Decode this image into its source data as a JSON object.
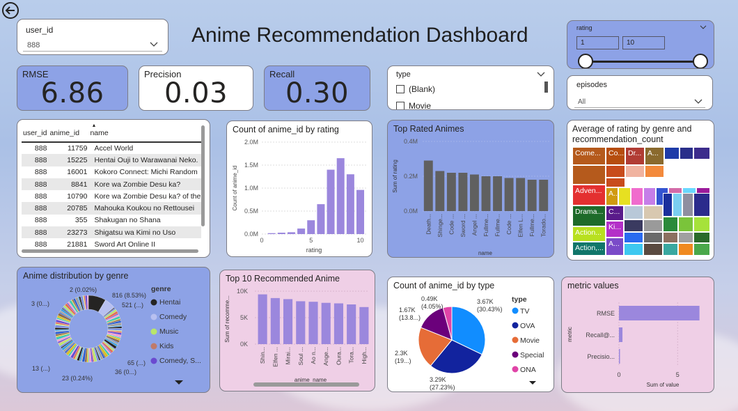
{
  "title": "Anime Recommendation Dashboard",
  "user_filter": {
    "label": "user_id",
    "value": "888"
  },
  "rating_slicer": {
    "label": "rating",
    "min": "1",
    "max": "10"
  },
  "type_slicer": {
    "label": "type",
    "options": [
      "(Blank)",
      "Movie"
    ]
  },
  "episodes_slicer": {
    "label": "episodes",
    "value": "All"
  },
  "kpis": {
    "rmse": {
      "label": "RMSE",
      "value": "6.86"
    },
    "precision": {
      "label": "Precision",
      "value": "0.03"
    },
    "recall": {
      "label": "Recall",
      "value": "0.30"
    }
  },
  "table": {
    "columns": [
      "user_id",
      "anime_id",
      "name"
    ],
    "rows": [
      [
        "888",
        "11759",
        "Accel World"
      ],
      [
        "888",
        "15225",
        "Hentai Ouji to Warawanai Neko."
      ],
      [
        "888",
        "16001",
        "Kokoro Connect: Michi Random"
      ],
      [
        "888",
        "8841",
        "Kore wa Zombie Desu ka?"
      ],
      [
        "888",
        "10790",
        "Kore wa Zombie Desu ka? of the"
      ],
      [
        "888",
        "20785",
        "Mahouka Koukou no Rettousei"
      ],
      [
        "888",
        "355",
        "Shakugan no Shana"
      ],
      [
        "888",
        "23273",
        "Shigatsu wa Kimi no Uso"
      ],
      [
        "888",
        "21881",
        "Sword Art Online II"
      ]
    ]
  },
  "colors": {
    "accent": "#9b87dd",
    "bar_dark": "#606060",
    "panel_blue": "#8da2e6",
    "panel_pink": "#efcfe6"
  },
  "chart_data": [
    {
      "type": "bar",
      "title": "Count of anime_id by rating",
      "xlabel": "rating",
      "ylabel": "Count of anime_id",
      "x": [
        1,
        2,
        3,
        4,
        5,
        6,
        7,
        8,
        9,
        10
      ],
      "values": [
        20000,
        30000,
        40000,
        120000,
        300000,
        650000,
        1400000,
        1650000,
        1300000,
        960000
      ],
      "ylim": [
        0,
        2000000
      ],
      "yticks": [
        "0.0M",
        "0.5M",
        "1.0M",
        "1.5M",
        "2.0M"
      ],
      "xticks": [
        "0",
        "5",
        "10"
      ]
    },
    {
      "type": "bar",
      "title": "Top Rated Animes",
      "xlabel": "name",
      "ylabel": "Sum of rating",
      "categories": [
        "Death...",
        "Shinge...",
        "Code ...",
        "Sword ...",
        "Angel ...",
        "Fullme...",
        "Fullme...",
        "Code ...",
        "Elfen L...",
        "Fullme...",
        "Toradо..."
      ],
      "values": [
        0.29,
        0.23,
        0.22,
        0.22,
        0.21,
        0.2,
        0.2,
        0.19,
        0.19,
        0.18,
        0.18
      ],
      "ylim": [
        0,
        0.4
      ],
      "yticks": [
        "0.0M",
        "0.2M",
        "0.4M"
      ]
    },
    {
      "type": "heatmap",
      "title": "Average of rating by genre and recommendation_count",
      "labels": [
        "Come...",
        "Co...",
        "Dr...",
        "A...",
        "Adven...",
        "A...",
        "C...",
        "Ki...",
        "Drama...",
        "A...",
        "Action...",
        "Action,..."
      ]
    },
    {
      "type": "pie",
      "title": "Anime distribution by genre",
      "legend_title": "genre",
      "legend": [
        "Hentai",
        "Comedy",
        "Music",
        "Kids",
        "Comedy, S..."
      ],
      "labels": [
        "816 (8.53%)",
        "521 (...)",
        "65 (...)",
        "36 (0...)",
        "23 (0.24%)",
        "13 (...)",
        "3 (0...)",
        "2 (0.02%)"
      ]
    },
    {
      "type": "bar",
      "title": "Top 10 Recommended Anime",
      "xlabel": "anime_name",
      "ylabel": "Sum of recomme...",
      "categories": [
        "Shin...",
        "Elfen ...",
        "Mirai...",
        "Soul ...",
        "Ao n...",
        "Ange...",
        "Oura...",
        "Tora...",
        "High..."
      ],
      "values": [
        9400,
        8700,
        8500,
        8100,
        8000,
        7800,
        7700,
        7500,
        7000
      ],
      "ylim": [
        0,
        10000
      ],
      "yticks": [
        "0K",
        "5K",
        "10K"
      ]
    },
    {
      "type": "pie",
      "title": "Count of anime_id by type",
      "legend_title": "type",
      "legend": [
        "TV",
        "OVA",
        "Movie",
        "Special",
        "ONA"
      ],
      "series": [
        {
          "name": "TV",
          "value": 3670,
          "label": "3.67K (30.43%)",
          "color": "#118dff"
        },
        {
          "name": "OVA",
          "value": 3290,
          "label": "3.29K (27.23%)",
          "color": "#12239e"
        },
        {
          "name": "Movie",
          "value": 2300,
          "label": "2.3K (19...)",
          "color": "#e66c37"
        },
        {
          "name": "Special",
          "value": 1670,
          "label": "1.67K (13.8...)",
          "color": "#6b007b"
        },
        {
          "name": "ONA",
          "value": 490,
          "label": "0.49K (4.05%)",
          "color": "#e044a7"
        }
      ]
    },
    {
      "type": "bar",
      "orientation": "horizontal",
      "title": "metric values",
      "xlabel": "Sum of value",
      "ylabel": "metric",
      "categories": [
        "RMSE",
        "Recall@...",
        "Precisio..."
      ],
      "values": [
        6.86,
        0.3,
        0.03
      ],
      "xlim": [
        0,
        7
      ],
      "xticks": [
        "0",
        "5"
      ]
    }
  ]
}
